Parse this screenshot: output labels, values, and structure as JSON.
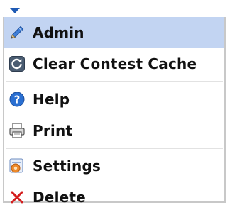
{
  "menu": {
    "items": [
      {
        "label": "Admin",
        "icon": "pencil-icon"
      },
      {
        "label": "Clear Contest Cache",
        "icon": "refresh-icon"
      },
      {
        "label": "Help",
        "icon": "help-icon"
      },
      {
        "label": "Print",
        "icon": "printer-icon"
      },
      {
        "label": "Settings",
        "icon": "settings-icon"
      },
      {
        "label": "Delete",
        "icon": "delete-icon"
      }
    ]
  },
  "colors": {
    "hover_background": "#c2d4f2",
    "arrow": "#1e5ab4",
    "delete_icon": "#d41e1e",
    "help_icon": "#2a6fd1"
  }
}
